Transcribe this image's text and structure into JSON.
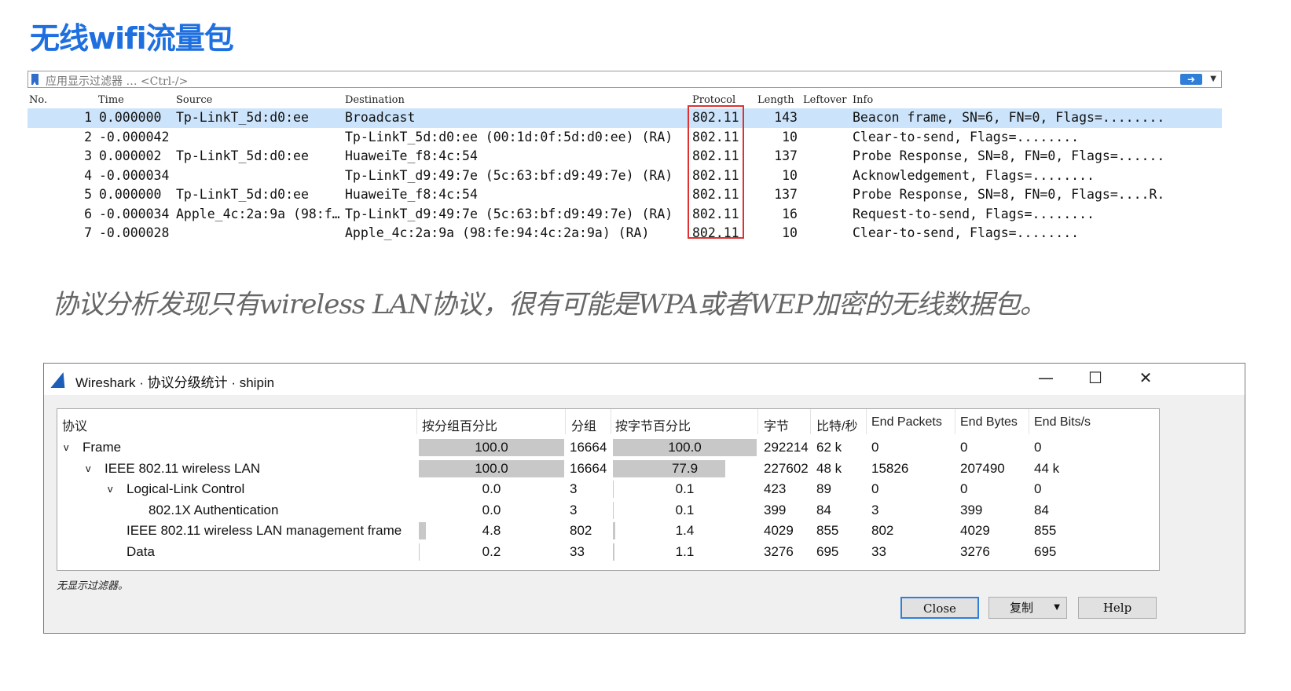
{
  "page_title": "无线wifi流量包",
  "filter": {
    "placeholder": "应用显示过滤器 … <Ctrl-/>"
  },
  "packet_list": {
    "headers": [
      "No.",
      "Time",
      "Source",
      "Destination",
      "Protocol",
      "Length",
      "Leftover",
      "Info"
    ],
    "rows": [
      {
        "no": "1",
        "time": "0.000000",
        "src": "Tp-LinkT_5d:d0:ee",
        "dst": "Broadcast",
        "proto": "802.11",
        "len": "143",
        "info": "Beacon frame, SN=6, FN=0, Flags=........"
      },
      {
        "no": "2",
        "time": "-0.000042",
        "src": "",
        "dst": "Tp-LinkT_5d:d0:ee (00:1d:0f:5d:d0:ee) (RA)",
        "proto": "802.11",
        "len": "10",
        "info": "Clear-to-send, Flags=........"
      },
      {
        "no": "3",
        "time": "0.000002",
        "src": "Tp-LinkT_5d:d0:ee",
        "dst": "HuaweiTe_f8:4c:54",
        "proto": "802.11",
        "len": "137",
        "info": "Probe Response, SN=8, FN=0, Flags=......"
      },
      {
        "no": "4",
        "time": "-0.000034",
        "src": "",
        "dst": "Tp-LinkT_d9:49:7e (5c:63:bf:d9:49:7e) (RA)",
        "proto": "802.11",
        "len": "10",
        "info": "Acknowledgement, Flags=........"
      },
      {
        "no": "5",
        "time": "0.000000",
        "src": "Tp-LinkT_5d:d0:ee",
        "dst": "HuaweiTe_f8:4c:54",
        "proto": "802.11",
        "len": "137",
        "info": "Probe Response, SN=8, FN=0, Flags=....R."
      },
      {
        "no": "6",
        "time": "-0.000034",
        "src": "Apple_4c:2a:9a (98:f…",
        "dst": "Tp-LinkT_d9:49:7e (5c:63:bf:d9:49:7e) (RA)",
        "proto": "802.11",
        "len": "16",
        "info": "Request-to-send, Flags=........"
      },
      {
        "no": "7",
        "time": "-0.000028",
        "src": "",
        "dst": "Apple_4c:2a:9a (98:fe:94:4c:2a:9a) (RA)",
        "proto": "802.11",
        "len": "10",
        "info": "Clear-to-send, Flags=........"
      }
    ]
  },
  "caption": "协议分析发现只有wireless LAN协议，很有可能是WPA或者WEP加密的无线数据包。",
  "dialog": {
    "title": "Wireshark · 协议分级统计 · shipin",
    "controls": {
      "minimize": "—",
      "maximize": "☐",
      "close": "✕"
    },
    "headers": [
      "协议",
      "按分组百分比",
      "分组",
      "按字节百分比",
      "字节",
      "比特/秒",
      "End Packets",
      "End Bytes",
      "End Bits/s"
    ],
    "rows": [
      {
        "name": "Frame",
        "expand": "v",
        "pkt_pct": "100.0",
        "pkts": "16664",
        "byte_pct": "100.0",
        "bytes": "292214",
        "bps": "62 k",
        "end_pkts": "0",
        "end_bytes": "0",
        "end_bps": "0"
      },
      {
        "name": "IEEE 802.11 wireless LAN",
        "expand": "v",
        "pkt_pct": "100.0",
        "pkts": "16664",
        "byte_pct": "77.9",
        "bytes": "227602",
        "bps": "48 k",
        "end_pkts": "15826",
        "end_bytes": "207490",
        "end_bps": "44 k"
      },
      {
        "name": "Logical-Link Control",
        "expand": "v",
        "pkt_pct": "0.0",
        "pkts": "3",
        "byte_pct": "0.1",
        "bytes": "423",
        "bps": "89",
        "end_pkts": "0",
        "end_bytes": "0",
        "end_bps": "0"
      },
      {
        "name": "802.1X Authentication",
        "expand": "",
        "pkt_pct": "0.0",
        "pkts": "3",
        "byte_pct": "0.1",
        "bytes": "399",
        "bps": "84",
        "end_pkts": "3",
        "end_bytes": "399",
        "end_bps": "84"
      },
      {
        "name": "IEEE 802.11 wireless LAN management frame",
        "expand": "",
        "pkt_pct": "4.8",
        "pkts": "802",
        "byte_pct": "1.4",
        "bytes": "4029",
        "bps": "855",
        "end_pkts": "802",
        "end_bytes": "4029",
        "end_bps": "855"
      },
      {
        "name": "Data",
        "expand": "",
        "pkt_pct": "0.2",
        "pkts": "33",
        "byte_pct": "1.1",
        "bytes": "3276",
        "bps": "695",
        "end_pkts": "33",
        "end_bytes": "3276",
        "end_bps": "695"
      }
    ],
    "status": "无显示过滤器。",
    "buttons": {
      "close": "Close",
      "copy": "复制",
      "copy_arrow": "▼",
      "help": "Help"
    }
  },
  "colors": {
    "title": "#1e6fe0",
    "selected_row": "#cce4fb",
    "highlight_box": "#e03030",
    "bar": "#c8c8c8"
  }
}
